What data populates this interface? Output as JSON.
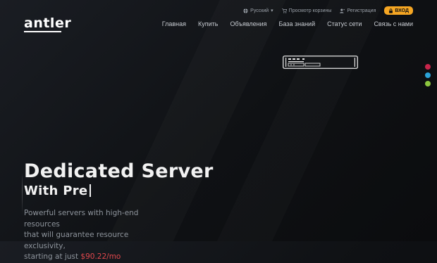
{
  "brand": {
    "logo_text": "antler"
  },
  "topbar": {
    "language": "Русский",
    "cart": "Просмотр корзины",
    "register": "Регистрация",
    "login": "ВХОД",
    "login_color": "#f5a623"
  },
  "nav": {
    "items": [
      "Главная",
      "Купить",
      "Объявления",
      "База знаний",
      "Статус сети",
      "Связь с нами"
    ]
  },
  "theme_dots": {
    "colors": [
      "#c8254b",
      "#2ba3d9",
      "#8cc63f"
    ]
  },
  "hero": {
    "title": "Dedicated Server",
    "subtitle": "With Pre",
    "description_lines": [
      "Powerful servers with high-end resources",
      "that will guarantee resource exclusivity,",
      "starting at just "
    ],
    "price": "$90.22/mo",
    "price_color": "#e0474c"
  }
}
